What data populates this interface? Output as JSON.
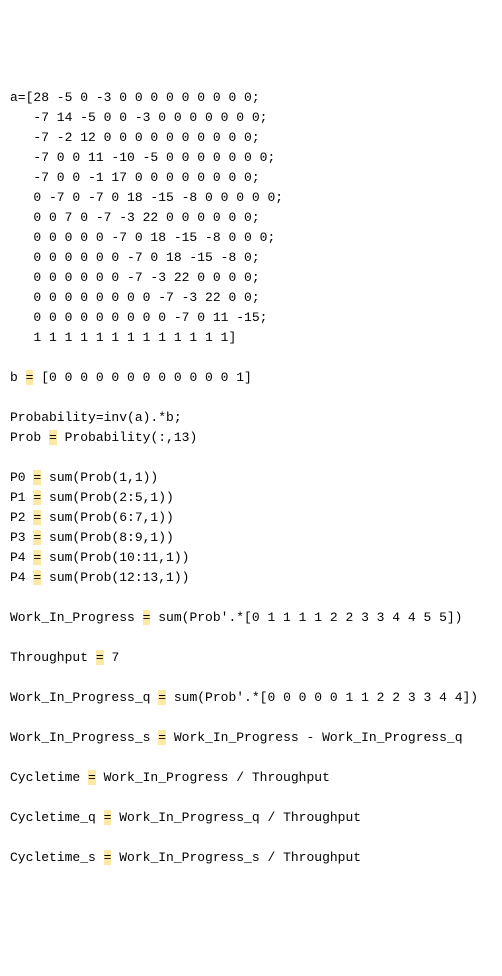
{
  "code": {
    "matrix_assign": "a=[",
    "matrix_rows": [
      "28 -5 0 -3 0 0 0 0 0 0 0 0 0;",
      "-7 14 -5 0 0 -3 0 0 0 0 0 0 0;",
      "-7 -2 12 0 0 0 0 0 0 0 0 0 0;",
      "-7 0 0 11 -10 -5 0 0 0 0 0 0 0;",
      "-7 0 0 -1 17 0 0 0 0 0 0 0 0;",
      "0 -7 0 -7 0 18 -15 -8 0 0 0 0 0;",
      "0 0 7 0 -7 -3 22 0 0 0 0 0 0;",
      "0 0 0 0 0 -7 0 18 -15 -8 0 0 0;",
      "0 0 0 0 0 0 -7 0 18 -15 -8 0;",
      "0 0 0 0 0 0 -7 -3 22 0 0 0 0;",
      "0 0 0 0 0 0 0 0 -7 -3 22 0 0;",
      "0 0 0 0 0 0 0 0 0 -7 0 11 -15;",
      "1 1 1 1 1 1 1 1 1 1 1 1 1]"
    ],
    "b_lhs": "b ",
    "b_rhs": " [0 0 0 0 0 0 0 0 0 0 0 0 1]",
    "prob_line": "Probability=inv(a).*b;",
    "probcol_lhs": "Prob ",
    "probcol_rhs": " Probability(:,13)",
    "p0_lhs": "P0 ",
    "p0_rhs": " sum(Prob(1,1))",
    "p1_lhs": "P1 ",
    "p1_rhs": " sum(Prob(2:5,1))",
    "p2_lhs": "P2 ",
    "p2_rhs": " sum(Prob(6:7,1))",
    "p3_lhs": "P3 ",
    "p3_rhs": " sum(Prob(8:9,1))",
    "p4a_lhs": "P4 ",
    "p4a_rhs": " sum(Prob(10:11,1))",
    "p4b_lhs": "P4 ",
    "p4b_rhs": " sum(Prob(12:13,1))",
    "wip_lhs": "Work_In_Progress ",
    "wip_rhs": " sum(Prob'.*[0 1 1 1 1 2 2 3 3 4 4 5 5])",
    "thr_lhs": "Throughput ",
    "thr_rhs": " 7",
    "wipq_lhs": "Work_In_Progress_q ",
    "wipq_rhs": " sum(Prob'.*[0 0 0 0 0 1 1 2 2 3 3 4 4])",
    "wips_lhs": "Work_In_Progress_s ",
    "wips_rhs": " Work_In_Progress - Work_In_Progress_q",
    "ct_lhs": "Cycletime ",
    "ct_rhs": " Work_In_Progress / Throughput",
    "ctq_lhs": "Cycletime_q ",
    "ctq_rhs": " Work_In_Progress_q / Throughput",
    "cts_lhs": "Cycletime_s ",
    "cts_rhs": " Work_In_Progress_s / Throughput",
    "eq": "="
  }
}
